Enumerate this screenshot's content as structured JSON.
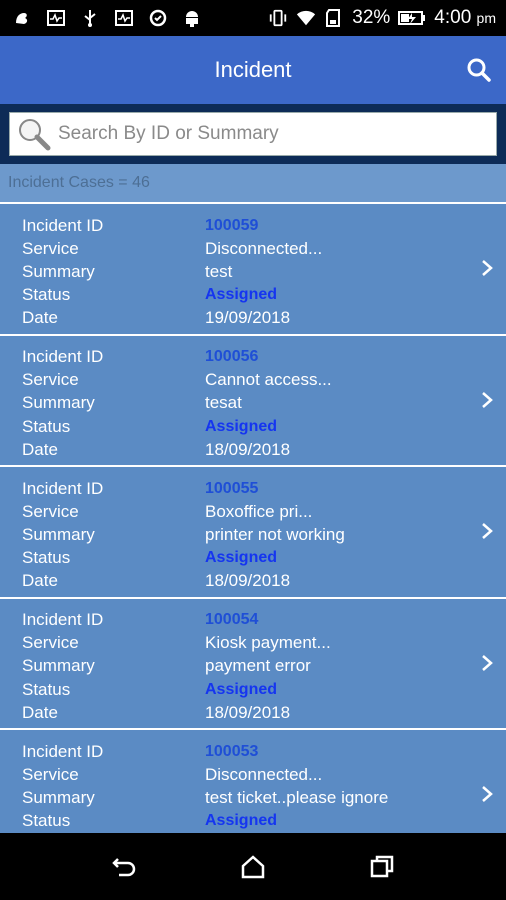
{
  "status_bar": {
    "battery": "32%",
    "time": "4:00",
    "ampm": "pm",
    "icons": [
      "notification-app-icon",
      "vitals-icon",
      "usb-icon",
      "vitals-icon",
      "sync-icon",
      "android-icon",
      "vibrate-icon",
      "wifi-icon",
      "sd-icon",
      "battery-charging-icon"
    ]
  },
  "appbar": {
    "title": "Incident",
    "search_icon": "search-icon"
  },
  "search": {
    "placeholder": "Search By ID or Summary",
    "value": ""
  },
  "count_label": "Incident Cases = 46",
  "labels": {
    "id": "Incident ID",
    "service": "Service",
    "summary": "Summary",
    "status": "Status",
    "date": "Date"
  },
  "incidents": [
    {
      "id": "100059",
      "service": "Disconnected...",
      "summary": "test",
      "status": "Assigned",
      "date": "19/09/2018"
    },
    {
      "id": "100056",
      "service": "Cannot access...",
      "summary": "tesat",
      "status": "Assigned",
      "date": "18/09/2018"
    },
    {
      "id": "100055",
      "service": "Boxoffice pri...",
      "summary": "printer not working",
      "status": "Assigned",
      "date": "18/09/2018"
    },
    {
      "id": "100054",
      "service": "Kiosk payment...",
      "summary": "payment error",
      "status": "Assigned",
      "date": "18/09/2018"
    },
    {
      "id": "100053",
      "service": "Disconnected...",
      "summary": "test ticket..please ignore",
      "status": "Assigned",
      "date": ""
    }
  ],
  "colors": {
    "appbar": "#3c68c8",
    "list_bg": "#5b8bc4",
    "id_text": "#1f4fd6",
    "status_text": "#1535f0"
  },
  "navbar": {
    "icons": [
      "back-icon",
      "home-icon",
      "recents-icon"
    ]
  }
}
